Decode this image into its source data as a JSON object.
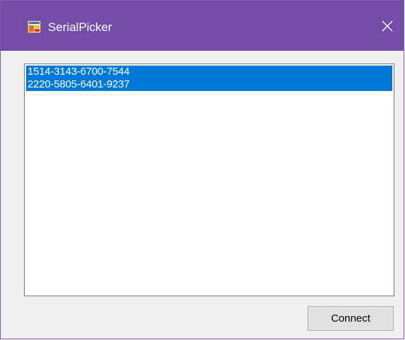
{
  "window": {
    "title": "SerialPicker",
    "icon": "form-app-icon",
    "close_icon": "close-icon"
  },
  "serial_list": {
    "items": [
      {
        "label": "1514-3143-6700-7544",
        "selected": true
      },
      {
        "label": "2220-5805-6401-9237",
        "selected": true
      }
    ]
  },
  "actions": {
    "connect_label": "Connect"
  },
  "colors": {
    "titlebar": "#744da9",
    "selection": "#0078d7",
    "button_face": "#e1e1e1",
    "window_face": "#f0f0f0"
  }
}
